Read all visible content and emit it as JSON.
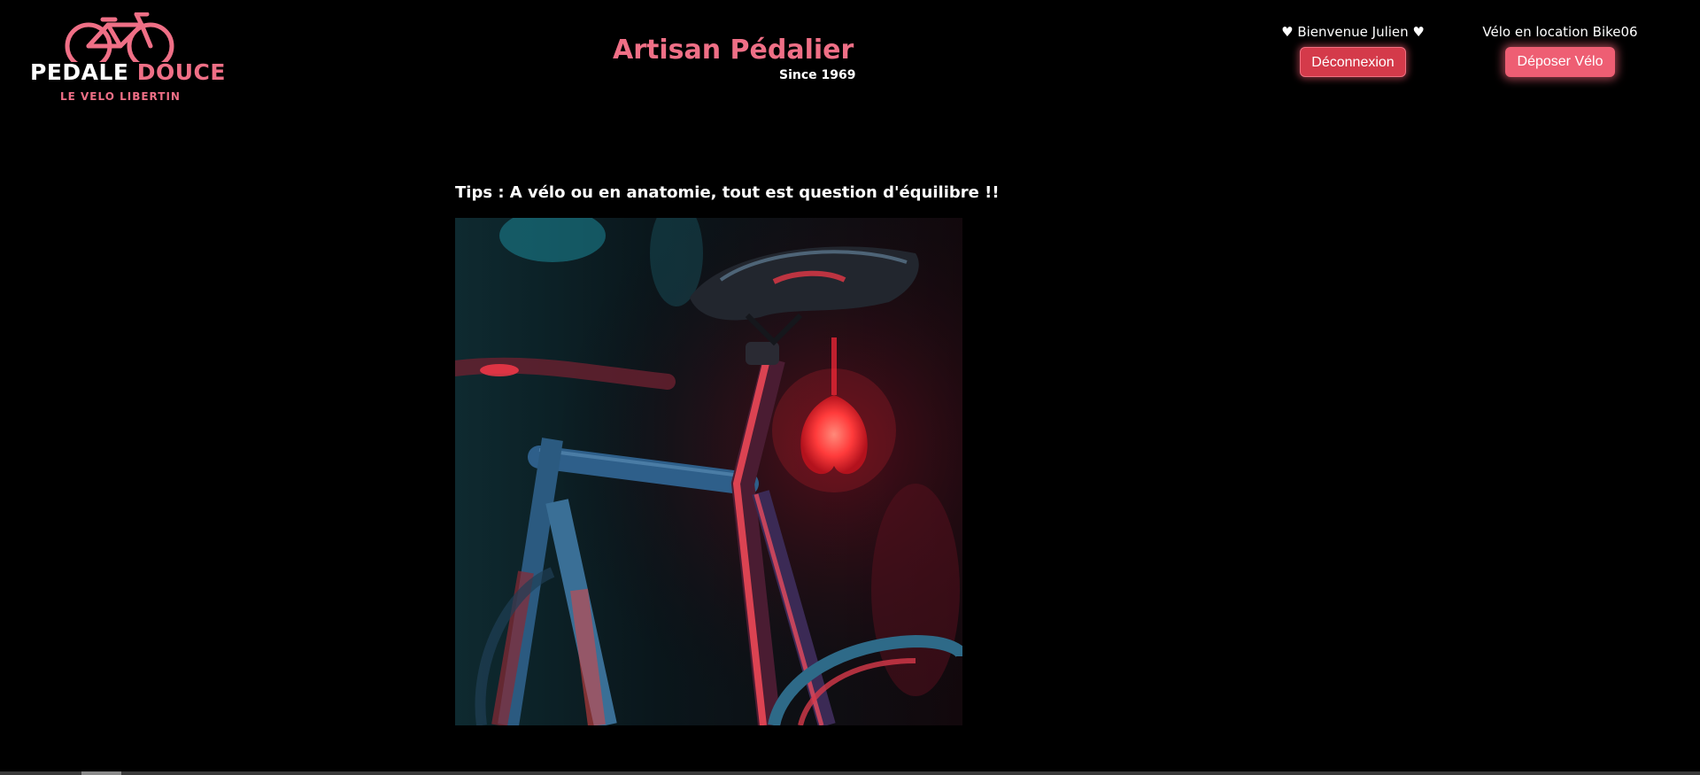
{
  "logo": {
    "word1": "PEDALE",
    "word2": "DOUCE",
    "tagline": "LE VELO LIBERTIN",
    "icon": "bicycle-icon",
    "color": "#ef6f86"
  },
  "header": {
    "title": "Artisan Pédalier",
    "subtitle": "Since 1969",
    "title_color": "#ef6f86"
  },
  "user": {
    "welcome": "♥ Bienvenue Julien ♥",
    "logout_label": "Déconnexion",
    "rental_status": "Vélo en location Bike06",
    "deposit_label": "Déposer Vélo"
  },
  "main": {
    "tip": "Tips : A vélo ou en anatomie, tout est question d'équilibre !!",
    "photo_subject": "bicycle-with-heart-tail-light"
  },
  "colors": {
    "background": "#000000",
    "accent": "#ef6f86",
    "logout_button": "#d43a4a",
    "deposit_button": "#ee5e73"
  }
}
